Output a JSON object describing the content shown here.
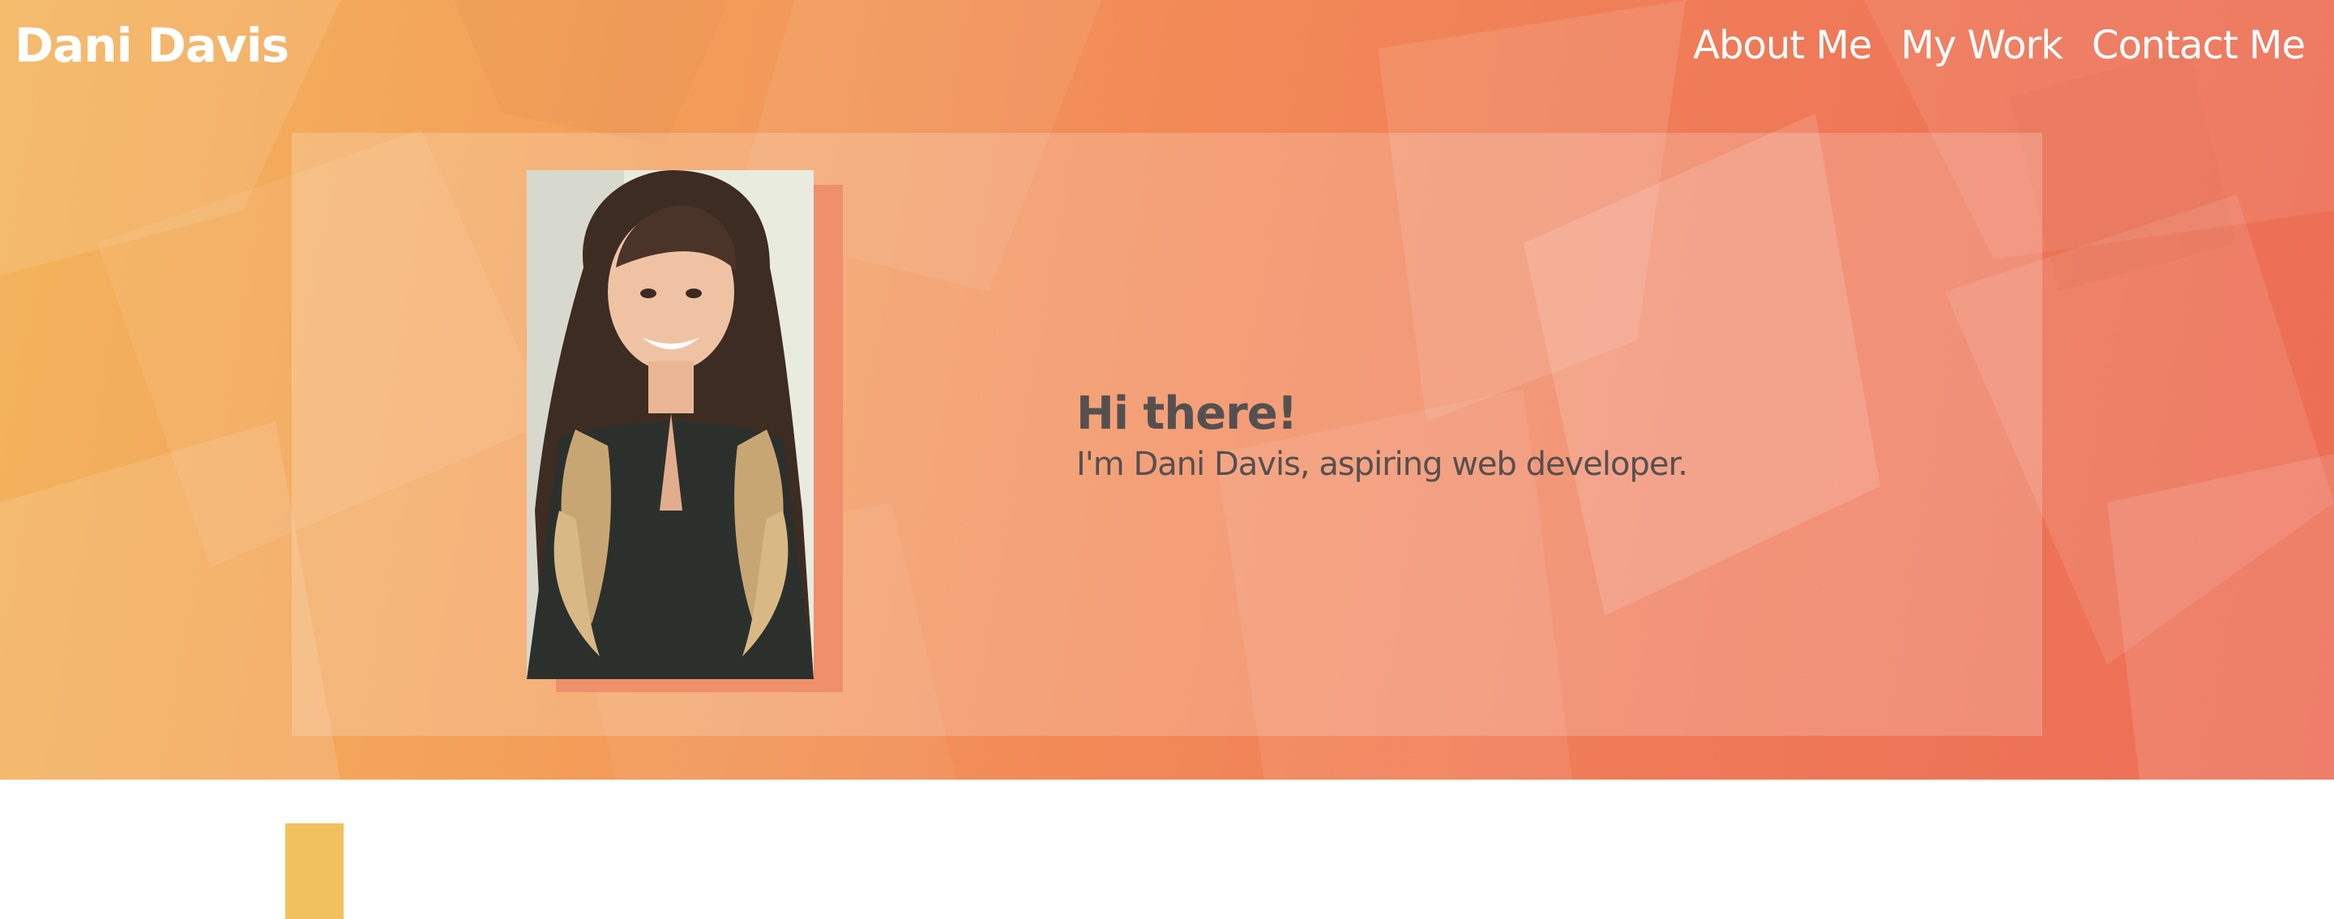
{
  "site": {
    "title": "Dani Davis"
  },
  "nav": {
    "items": [
      {
        "label": "About Me"
      },
      {
        "label": "My Work"
      },
      {
        "label": "Contact Me"
      }
    ]
  },
  "hero": {
    "heading": "Hi there!",
    "subheading": "I'm Dani Davis, aspiring web developer.",
    "photo_icon": "portrait-photo"
  },
  "colors": {
    "hero_gradient_start": "#f3b45d",
    "hero_gradient_end": "#ec6d55",
    "photo_shadow": "#ef8f6b",
    "accent_block": "#f2c15f",
    "text_dark": "#555050",
    "text_light": "#ffffff"
  }
}
